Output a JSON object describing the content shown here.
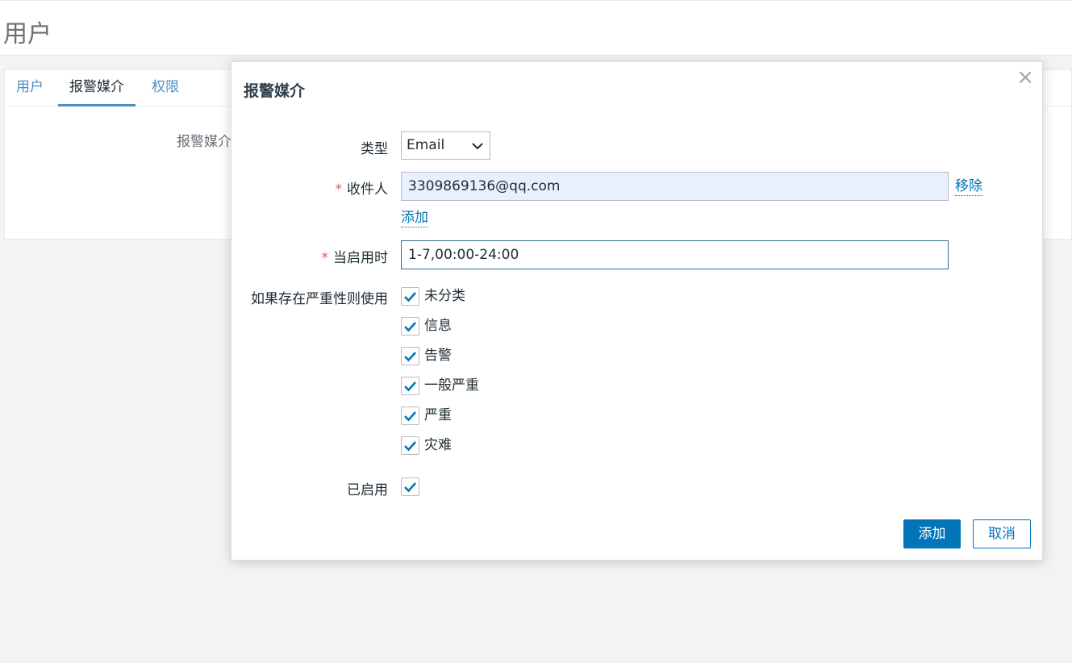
{
  "page": {
    "title": "用户"
  },
  "background": {
    "tabs": [
      {
        "label": "用户"
      },
      {
        "label": "报警媒介"
      },
      {
        "label": "权限"
      }
    ],
    "media_label": "报警媒介"
  },
  "modal": {
    "title": "报警媒介",
    "close_glyph": "×",
    "type_label": "类型",
    "type_value": "Email",
    "recipient_label": "收件人",
    "recipient_value": "3309869136@qq.com",
    "remove_link": "移除",
    "add_link": "添加",
    "when_active_label": "当启用时",
    "when_active_value": "1-7,00:00-24:00",
    "severity_label": "如果存在严重性则使用",
    "severities": [
      {
        "label": "未分类",
        "checked": true
      },
      {
        "label": "信息",
        "checked": true
      },
      {
        "label": "告警",
        "checked": true
      },
      {
        "label": "一般严重",
        "checked": true
      },
      {
        "label": "严重",
        "checked": true
      },
      {
        "label": "灾难",
        "checked": true
      }
    ],
    "enabled_label": "已启用",
    "enabled_checked": true,
    "required_marker": "*",
    "add_button": "添加",
    "cancel_button": "取消"
  },
  "colors": {
    "accent": "#0275b8",
    "required": "#e45959",
    "filled_input": "#e8f0fe"
  }
}
